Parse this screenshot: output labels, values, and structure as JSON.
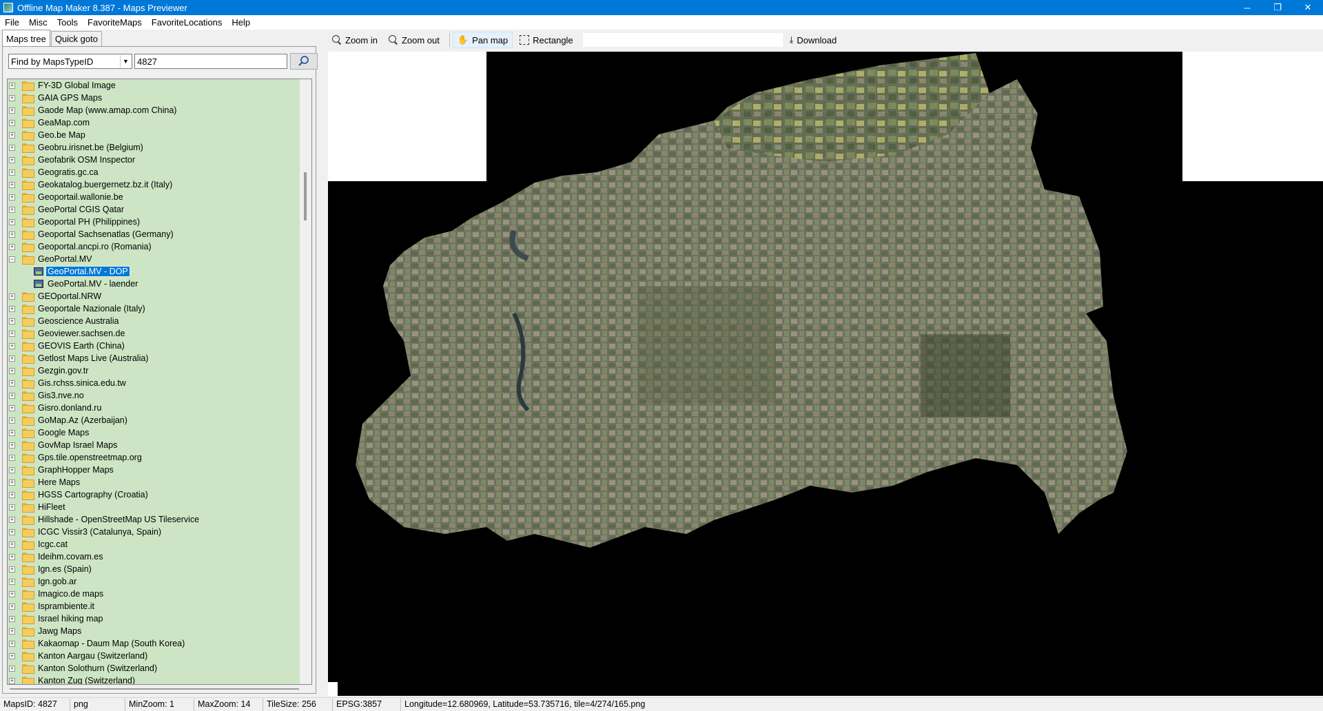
{
  "window": {
    "title": "Offline Map Maker 8.387 - Maps Previewer",
    "minimize": "─",
    "maximize": "❐",
    "close": "✕"
  },
  "menu": [
    "File",
    "Misc",
    "Tools",
    "FavoriteMaps",
    "FavoriteLocations",
    "Help"
  ],
  "tabs": {
    "maps_tree": "Maps tree",
    "quick_goto": "Quick goto"
  },
  "find": {
    "mode": "Find by MapsTypeID",
    "value": "4827"
  },
  "tree": {
    "items_before": [
      "FY-3D Global Image",
      "GAIA GPS Maps",
      "Gaode Map (www.amap.com China)",
      "GeaMap.com",
      "Geo.be Map",
      "Geobru.irisnet.be (Belgium)",
      "Geofabrik OSM Inspector",
      "Geogratis.gc.ca",
      "Geokatalog.buergernetz.bz.it (Italy)",
      "Geoportail.wallonie.be",
      "GeoPortal CGIS Qatar",
      "Geoportal PH (Philippines)",
      "Geoportal Sachsenatlas (Germany)",
      "Geoportal.ancpi.ro (Romania)"
    ],
    "expanded": "GeoPortal.MV",
    "children": [
      "GeoPortal.MV - DOP",
      "GeoPortal.MV - laender"
    ],
    "selected_child": 0,
    "items_after": [
      "GEOportal.NRW",
      "Geoportale Nazionale (Italy)",
      "Geoscience Australia",
      "Geoviewer.sachsen.de",
      "GEOVIS Earth (China)",
      "Getlost Maps Live (Australia)",
      "Gezgin.gov.tr",
      "Gis.rchss.sinica.edu.tw",
      "Gis3.nve.no",
      "Gisro.donland.ru",
      "GoMap.Az (Azerbaijan)",
      "Google Maps",
      "GovMap Israel Maps",
      "Gps.tile.openstreetmap.org",
      "GraphHopper Maps",
      "Here Maps",
      "HGSS Cartography (Croatia)",
      "HiFleet",
      "Hillshade - OpenStreetMap US Tileservice",
      "ICGC Vissir3 (Catalunya, Spain)",
      "Icgc.cat",
      "Ideihm.covam.es",
      "Ign.es (Spain)",
      "Ign.gob.ar",
      "Imagico.de maps",
      "Isprambiente.it",
      "Israel hiking map",
      "Jawg Maps",
      "Kakaomap - Daum Map (South Korea)",
      "Kanton Aargau (Switzerland)",
      "Kanton Solothurn (Switzerland)",
      "Kanton Zug (Switzerland)"
    ]
  },
  "toolbar": {
    "zoom_in": "Zoom in",
    "zoom_out": "Zoom out",
    "pan_map": "Pan map",
    "rectangle": "Rectangle",
    "download": "Download"
  },
  "status": {
    "maps_id": "MapsID: 4827",
    "format": "png",
    "min_zoom": "MinZoom: 1",
    "max_zoom": "MaxZoom: 14",
    "tile_size": "TileSize: 256",
    "epsg": "EPSG:3857",
    "position": "Longitude=12.680969, Latitude=53.735716, tile=4/274/165.png"
  },
  "colors": {
    "titlebar": "#0078d7",
    "tree_background": "#cde5c4",
    "selection": "#0078d7",
    "map_background": "#000000"
  }
}
